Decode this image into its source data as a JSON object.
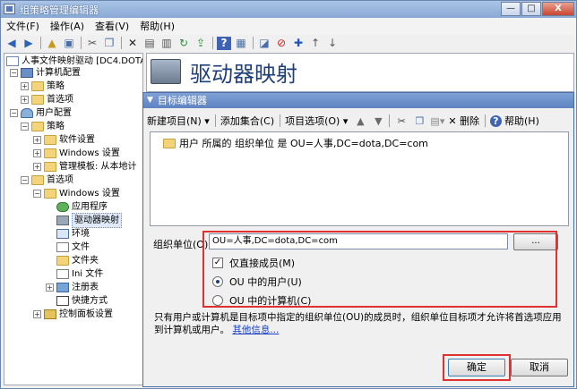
{
  "window": {
    "title": "组策略管理编辑器",
    "controls": {
      "minimize": "—",
      "maximize": "□",
      "close": "X"
    }
  },
  "menu": [
    "文件(F)",
    "操作(A)",
    "查看(V)",
    "帮助(H)"
  ],
  "toolbar_icons": [
    "back-icon",
    "forward-icon",
    "up-icon",
    "show-hide-icon",
    "cut-icon",
    "copy-icon",
    "delete-icon",
    "properties-icon",
    "print-icon",
    "refresh-icon",
    "export-icon",
    "help-icon",
    "view-icon",
    "new-icon",
    "block-icon",
    "add-icon",
    "up-arrow-icon",
    "down-arrow-icon"
  ],
  "tree": {
    "root": "人事文件映射驱动 [DC4.DOTA.C",
    "computer_config": "计算机配置",
    "cc_policies": "策略",
    "cc_preferences": "首选项",
    "user_config": "用户配置",
    "uc_policies": "策略",
    "software_settings": "软件设置",
    "windows_settings": "Windows 设置",
    "admin_templates": "管理模板: 从本地计",
    "uc_preferences": "首选项",
    "pref_windows_settings": "Windows 设置",
    "applications": "应用程序",
    "drive_maps": "驱动器映射",
    "environment": "环境",
    "files": "文件",
    "folders": "文件夹",
    "ini_files": "Ini 文件",
    "registry": "注册表",
    "shortcuts": "快捷方式",
    "control_panel": "控制面板设置"
  },
  "right_header": {
    "title": "驱动器映射"
  },
  "dialog": {
    "title": "目标编辑器",
    "toolbar": {
      "new_item": "新建项目(N)",
      "add_collection": "添加集合(C)",
      "item_options": "项目选项(O)",
      "delete": "删除",
      "help": "帮助(H)"
    },
    "target_item": "用户 所属的 组织单位 是 OU=人事,DC=dota,DC=com",
    "ou_label": "组织单位(O)",
    "ou_value": "OU=人事,DC=dota,DC=com",
    "browse": "...",
    "direct_member": "仅直接成员(M)",
    "direct_member_checked": true,
    "option_users": "OU 中的用户(U)",
    "option_computers": "OU 中的计算机(C)",
    "selected_option": "users",
    "description": "只有用户或计算机是目标项中指定的组织单位(OU)的成员时，组织单位目标项才允许将首选项应用到计算机或用户。",
    "more_info": "其他信息...",
    "ok": "确定",
    "cancel": "取消"
  },
  "highlight_color": "#e03030"
}
